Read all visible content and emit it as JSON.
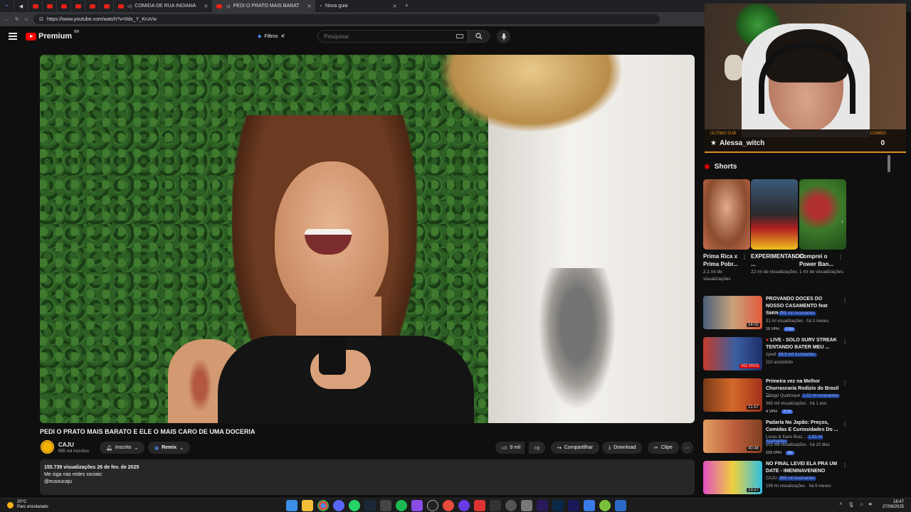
{
  "browser": {
    "tabs": [
      {
        "label": "COMIDA DE RUA INDIANA"
      },
      {
        "label": "PEDI O PRATO MAIS BARAT"
      },
      {
        "label": "Nova guia"
      }
    ],
    "url": "https://www.youtube.com/watch?v=0dx_Y_KruVw"
  },
  "header": {
    "logo_text": "Premium",
    "region": "BR",
    "filters_label": "Filtros",
    "search_placeholder": "Pesquisar"
  },
  "video": {
    "title": "PEDI O PRATO MAIS BARATO E ELE O MAIS CARO DE UMA DOCERIA",
    "channel": "CAJU",
    "subscribers": "985 mil inscritos",
    "subscribed_label": "Inscrito",
    "remix_label": "Remix",
    "likes": "9 mil",
    "share_label": "Compartilhar",
    "download_label": "Download",
    "clip_label": "Clipe",
    "views_date": "155.739 visualizações  26 de fev. de 2025",
    "desc_line1": "Me siga nas redes sociais:",
    "desc_line2": "@eusoucaju"
  },
  "stream_overlay": {
    "last_sub_label": "ÚLTIMO SUB",
    "last_sub_name": "Alessa_witch",
    "combo_label": "COMBO",
    "combo_value": "0"
  },
  "sidebar": {
    "shorts_title": "Shorts",
    "shorts": [
      {
        "title": "Prima Rica x Prima Pobr...",
        "views": "2,1 mi de visualizações"
      },
      {
        "title": "EXPERIMENTANDO ...",
        "views": "22 mi de visualizações"
      },
      {
        "title": "Comprei o Power Ban...",
        "views": "1 mi de visualizações"
      }
    ],
    "recommended": [
      {
        "title": "PROVANDO DOCES DO NOSSO CASAMENTO feat Sermota",
        "channel": "CAJU",
        "members": "985 mil Assinantes",
        "meta": "31 mi visualizações · há 3 meses",
        "badge": "16 VPH",
        "ratio": "2.8x",
        "duration": "14:02"
      },
      {
        "title": "LIVE - SOLO SURV STREAK TENTANDO BATER MEU ...",
        "channel": "zyeef",
        "members": "68,9 mil Assinantes",
        "meta": "110 assistindo",
        "badge": "",
        "ratio": "",
        "duration": "AO VIVO"
      },
      {
        "title": "Primeira vez na Melhor Churrascaria Rodizio do Brasil ...",
        "channel": "Thiago Quatroque",
        "members": "1,02 mi Assinantes",
        "meta": "363 mil visualizações · há 1 ano",
        "badge": "4 VPH",
        "ratio": "2.7x",
        "duration": "21:57"
      },
      {
        "title": "Padaria No Japão: Preços, Comidas E Curiosidades Do ...",
        "channel": "Lucas & Kano Braz...",
        "members": "1,81 mi Assinantes",
        "meta": "101 mil visualizações · há 10 dias",
        "badge": "103 VPH",
        "ratio": "2x",
        "duration": "40:46"
      },
      {
        "title": "NO FINAL LEVEI ELA PRA UM DATE  - IMENINAVENENO",
        "channel": "CAJU",
        "members": "985 mil Assinantes",
        "meta": "199 mi visualizações · há 9 meses",
        "badge": "",
        "ratio": "",
        "duration": "23:27"
      }
    ]
  },
  "taskbar": {
    "temp": "20°C",
    "weather": "Parc ensolarado",
    "time": "18:47",
    "date": "27/08/2025"
  },
  "colors": {
    "youtube_red": "#ff0000",
    "accent_orange": "#e08f22",
    "bg": "#0f0f0f"
  }
}
